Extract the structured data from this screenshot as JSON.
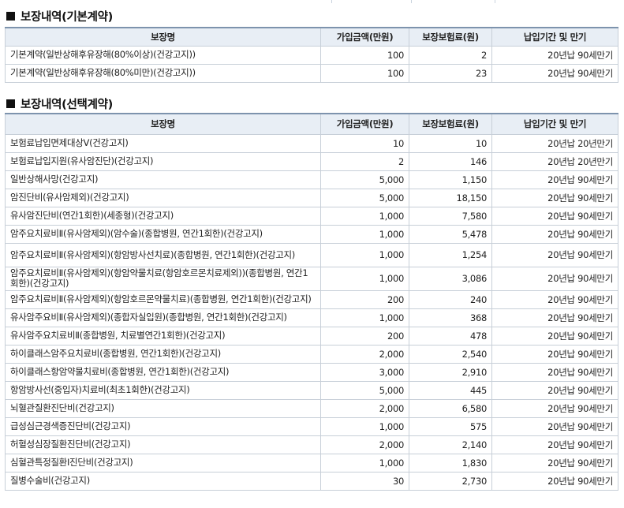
{
  "basic": {
    "title": "보장내역(기본계약)",
    "headers": [
      "보장명",
      "가입금액(만원)",
      "보장보험료(원)",
      "납입기간 및 만기"
    ],
    "rows": [
      {
        "name": "기본계약(일반상해후유장해(80%이상)(건강고지))",
        "amount": "100",
        "premium": "2",
        "period": "20년납 90세만기"
      },
      {
        "name": "기본계약(일반상해후유장해(80%미만)(건강고지))",
        "amount": "100",
        "premium": "23",
        "period": "20년납 90세만기"
      }
    ]
  },
  "optional": {
    "title": "보장내역(선택계약)",
    "headers": [
      "보장명",
      "가입금액(만원)",
      "보장보험료(원)",
      "납입기간 및 만기"
    ],
    "rows": [
      {
        "name": "보험료납입면제대상Ⅴ(건강고지)",
        "amount": "10",
        "premium": "10",
        "period": "20년납 20년만기"
      },
      {
        "name": "보험료납입지원(유사암진단)(건강고지)",
        "amount": "2",
        "premium": "146",
        "period": "20년납 20년만기"
      },
      {
        "name": "일반상해사망(건강고지)",
        "amount": "5,000",
        "premium": "1,150",
        "period": "20년납 90세만기"
      },
      {
        "name": "암진단비(유사암제외)(건강고지)",
        "amount": "5,000",
        "premium": "18,150",
        "period": "20년납 90세만기"
      },
      {
        "name": "유사암진단비(연간1회한)(세종형)(건강고지)",
        "amount": "1,000",
        "premium": "7,580",
        "period": "20년납 90세만기"
      },
      {
        "name": "암주요치료비Ⅱ(유사암제외)(암수술)(종합병원, 연간1회한)(건강고지)",
        "amount": "1,000",
        "premium": "5,478",
        "period": "20년납 90세만기"
      },
      {
        "name": "암주요치료비Ⅱ(유사암제외)(항암방사선치료)(종합병원, 연간1회한)(건강고지)",
        "amount": "1,000",
        "premium": "1,254",
        "period": "20년납 90세만기"
      },
      {
        "name": "암주요치료비Ⅱ(유사암제외)(항암약물치료(항암호르몬치료제외))(종합병원, 연간1회한)(건강고지)",
        "amount": "1,000",
        "premium": "3,086",
        "period": "20년납 90세만기"
      },
      {
        "name": "암주요치료비Ⅱ(유사암제외)(항암호르몬약물치료)(종합병원, 연간1회한)(건강고지)",
        "amount": "200",
        "premium": "240",
        "period": "20년납 90세만기"
      },
      {
        "name": "유사암주요비Ⅱ(유사암제외)(종합자실입원)(종합병원, 연간1회한)(건강고지)",
        "amount": "1,000",
        "premium": "368",
        "period": "20년납 90세만기"
      },
      {
        "name": "유사암주요치료비Ⅱ(종합병원, 치료별연간1회한)(건강고지)",
        "amount": "200",
        "premium": "478",
        "period": "20년납 90세만기"
      },
      {
        "name": "하이클래스암주요치료비(종합병원, 연간1회한)(건강고지)",
        "amount": "2,000",
        "premium": "2,540",
        "period": "20년납 90세만기"
      },
      {
        "name": "하이클래스항암약물치료비(종합병원, 연간1회한)(건강고지)",
        "amount": "3,000",
        "premium": "2,910",
        "period": "20년납 90세만기"
      },
      {
        "name": "항암방사선(중입자)치료비(최초1회한)(건강고지)",
        "amount": "5,000",
        "premium": "445",
        "period": "20년납 90세만기"
      },
      {
        "name": "뇌혈관질환진단비(건강고지)",
        "amount": "2,000",
        "premium": "6,580",
        "period": "20년납 90세만기"
      },
      {
        "name": "급성심근경색증진단비(건강고지)",
        "amount": "1,000",
        "premium": "575",
        "period": "20년납 90세만기"
      },
      {
        "name": "허혈성심장질환진단비(건강고지)",
        "amount": "2,000",
        "premium": "2,140",
        "period": "20년납 90세만기"
      },
      {
        "name": "심혈관특정질환Ⅰ진단비(건강고지)",
        "amount": "1,000",
        "premium": "1,830",
        "period": "20년납 90세만기"
      },
      {
        "name": "질병수술비(건강고지)",
        "amount": "30",
        "premium": "2,730",
        "period": "20년납 90세만기"
      }
    ]
  }
}
